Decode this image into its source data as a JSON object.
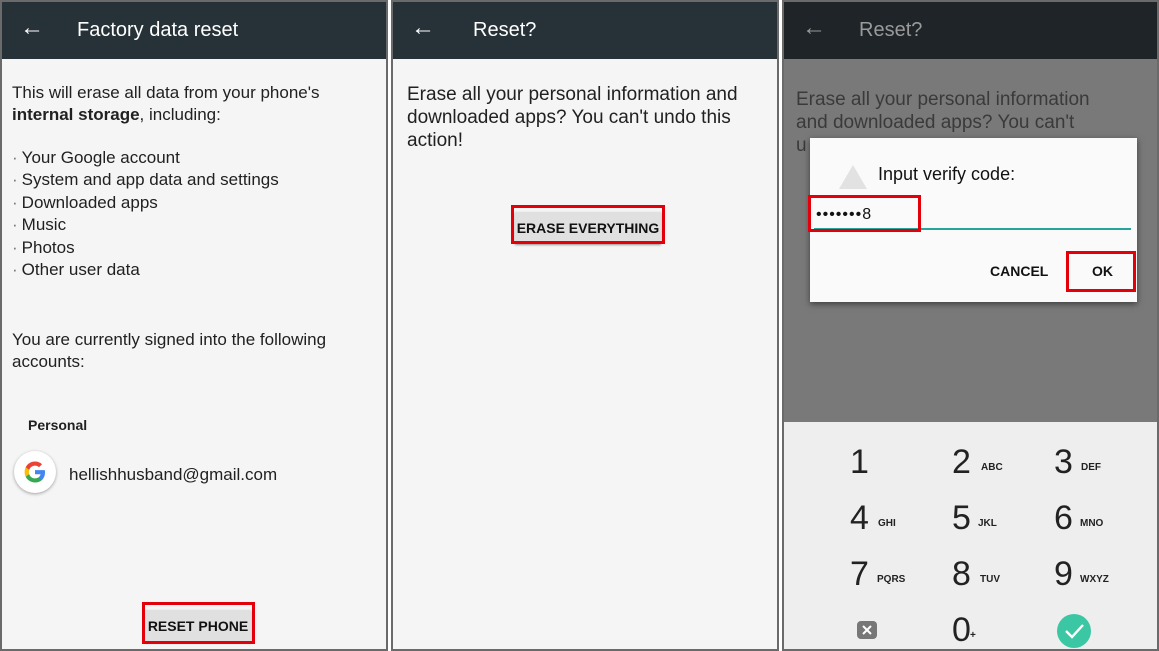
{
  "screen1": {
    "title": "Factory data reset",
    "intro_prefix": "This will erase all data from your phone's ",
    "intro_bold": "internal storage",
    "intro_suffix": ", including:",
    "items": [
      "Your Google account",
      "System and app data and settings",
      "Downloaded apps",
      "Music",
      "Photos",
      "Other user data"
    ],
    "signed_in_text": "You are currently signed into the following accounts:",
    "account_section": "Personal",
    "account_email": "hellishhusband@gmail.com",
    "reset_button": "RESET PHONE"
  },
  "screen2": {
    "title": "Reset?",
    "message": "Erase all your personal information and downloaded apps? You can't undo this action!",
    "erase_button": "ERASE EVERYTHING"
  },
  "screen3": {
    "title": "Reset?",
    "bg_line1": "Erase all your personal information",
    "bg_line2": "and downloaded apps? You can't",
    "bg_line3_fragment": "u",
    "dialog_title": "Input verify code:",
    "field_value": "•••••••8",
    "cancel_label": "CANCEL",
    "ok_label": "OK",
    "keys": [
      {
        "num": "1",
        "letters": ""
      },
      {
        "num": "2",
        "letters": "ABC"
      },
      {
        "num": "3",
        "letters": "DEF"
      },
      {
        "num": "4",
        "letters": "GHI"
      },
      {
        "num": "5",
        "letters": "JKL"
      },
      {
        "num": "6",
        "letters": "MNO"
      },
      {
        "num": "7",
        "letters": "PQRS"
      },
      {
        "num": "8",
        "letters": "TUV"
      },
      {
        "num": "9",
        "letters": "WXYZ"
      },
      {
        "num": "0",
        "letters": "+"
      }
    ]
  },
  "icons": {
    "back": "arrow-left-icon",
    "google": "google-logo",
    "warning": "warning-triangle-icon",
    "backspace": "backspace-icon",
    "done": "check-circle-icon"
  },
  "colors": {
    "appbar": "#263238",
    "highlight": "#e3000b",
    "accent": "#26a69a",
    "dim": "#797979"
  }
}
